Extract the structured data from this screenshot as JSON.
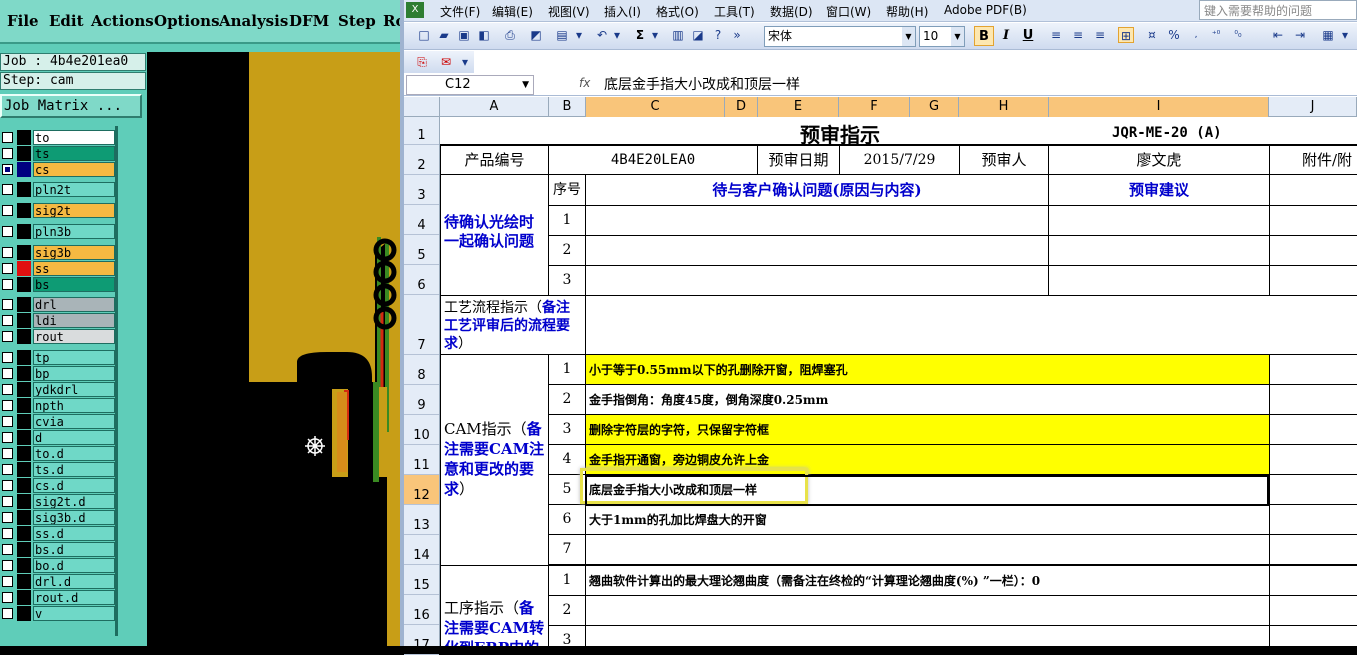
{
  "cam": {
    "menu": [
      "File",
      "Edit",
      "Actions",
      "Options",
      "Analysis",
      "DFM",
      "Step",
      "Ro"
    ],
    "job": "Job : 4b4e201ea0",
    "step": "Step: cam",
    "matrix_button": "Job Matrix ...",
    "layers": [
      {
        "name": "to",
        "color": "#ffffff",
        "checked": false
      },
      {
        "name": "ts",
        "color": "#0e9b74",
        "checked": false
      },
      {
        "name": "cs",
        "color": "#f5b942",
        "checked": true
      },
      {
        "name": "pln2t",
        "color": "#6fd8c7",
        "checked": false
      },
      {
        "name": "sig2t",
        "color": "#f5b942",
        "checked": false
      },
      {
        "name": "pln3b",
        "color": "#6fd8c7",
        "checked": false
      },
      {
        "name": "sig3b",
        "color": "#f5b942",
        "checked": false
      },
      {
        "name": "ss",
        "color": "#f5b942",
        "checked": false
      },
      {
        "name": "bs",
        "color": "#0e9b74",
        "checked": false
      },
      {
        "name": "drl",
        "color": "#a9b4b8",
        "checked": false
      },
      {
        "name": "ldi",
        "color": "#a9b4b8",
        "checked": false
      },
      {
        "name": "rout",
        "color": "#d9dcdd",
        "checked": false
      },
      {
        "name": "tp",
        "color": "#6fd8c7",
        "checked": false
      },
      {
        "name": "bp",
        "color": "#6fd8c7",
        "checked": false
      },
      {
        "name": "ydkdrl",
        "color": "#6fd8c7",
        "checked": false
      },
      {
        "name": "npth",
        "color": "#6fd8c7",
        "checked": false
      },
      {
        "name": "cvia",
        "color": "#6fd8c7",
        "checked": false
      },
      {
        "name": "d",
        "color": "#6fd8c7",
        "checked": false
      },
      {
        "name": "to.d",
        "color": "#6fd8c7",
        "checked": false
      },
      {
        "name": "ts.d",
        "color": "#6fd8c7",
        "checked": false
      },
      {
        "name": "cs.d",
        "color": "#6fd8c7",
        "checked": false
      },
      {
        "name": "sig2t.d",
        "color": "#6fd8c7",
        "checked": false
      },
      {
        "name": "sig3b.d",
        "color": "#6fd8c7",
        "checked": false
      },
      {
        "name": "ss.d",
        "color": "#6fd8c7",
        "checked": false
      },
      {
        "name": "bs.d",
        "color": "#6fd8c7",
        "checked": false
      },
      {
        "name": "bo.d",
        "color": "#6fd8c7",
        "checked": false
      },
      {
        "name": "drl.d",
        "color": "#6fd8c7",
        "checked": false
      },
      {
        "name": "rout.d",
        "color": "#6fd8c7",
        "checked": false
      },
      {
        "name": "v",
        "color": "#6fd8c7",
        "checked": false
      }
    ]
  },
  "excel": {
    "menu": [
      "文件(F)",
      "编辑(E)",
      "视图(V)",
      "插入(I)",
      "格式(O)",
      "工具(T)",
      "数据(D)",
      "窗口(W)",
      "帮助(H)",
      "Adobe PDF(B)"
    ],
    "help_placeholder": "键入需要帮助的问题",
    "font_name": "宋体",
    "font_size": "10",
    "name_box": "C12",
    "formula": "底层金手指大小改成和顶层一样",
    "columns": [
      "A",
      "B",
      "C",
      "D",
      "E",
      "F",
      "G",
      "H",
      "I",
      "J"
    ],
    "rows": [
      "1",
      "2",
      "3",
      "4",
      "5",
      "6",
      "7",
      "8",
      "9",
      "10",
      "11",
      "12",
      "13",
      "14",
      "15",
      "16",
      "17"
    ],
    "sheet": {
      "title": "预审指示",
      "doc_code": "JQR-ME-20 (A)",
      "product_no_label": "产品编号",
      "product_no": "4B4E20LEA0",
      "review_date_label": "预审日期",
      "review_date": "2015/7/29",
      "reviewer_label": "预审人",
      "reviewer": "廖文虎",
      "attachment_label": "附件/附",
      "seq_label": "序号",
      "issue_header": "待与客户确认问题(原因与内容)",
      "suggest_header": "预审建议",
      "section_confirm": "待确认光绘时一起确认问题",
      "section_process_a": "工艺流程指示（",
      "section_process_b": "备注工艺评审后的流程要求",
      "section_process_c": "）",
      "section_cam_a": "CAM指示（",
      "section_cam_b": "备注需要CAM注意和更改的要求",
      "section_cam_c": "）",
      "section_op_a": "工序指示（",
      "section_op_b": "备注需要CAM转化到ERP中的",
      "confirm_nums": [
        "1",
        "2",
        "3"
      ],
      "cam_nums": [
        "1",
        "2",
        "3",
        "4",
        "5",
        "6",
        "7"
      ],
      "cam_items": [
        "小于等于0.55mm以下的孔删除开窗，阻焊塞孔",
        "金手指倒角：角度45度，倒角深度0.25mm",
        "删除字符层的字符，只保留字符框",
        "金手指开通窗，旁边铜皮允许上金",
        "底层金手指大小改成和顶层一样",
        "大于1mm的孔加比焊盘大的开窗",
        ""
      ],
      "op_nums": [
        "1",
        "2",
        "3"
      ],
      "op_items": [
        "翘曲软件计算出的最大理论翘曲度（需备注在终检的“计算理论翘曲度(%) ”一栏）：0",
        "",
        ""
      ]
    }
  }
}
